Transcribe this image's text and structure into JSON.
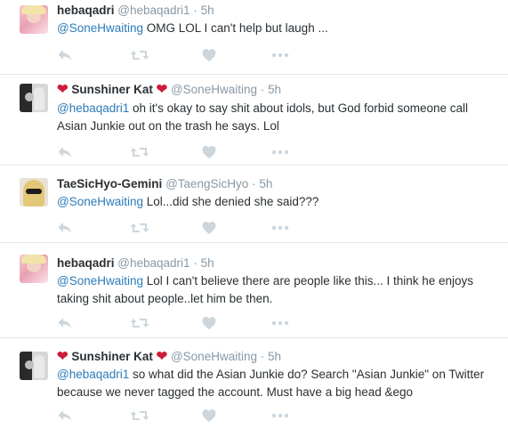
{
  "colors": {
    "name_text": "#292f33",
    "meta_text": "#8899a6",
    "link_blue": "#2b7bb9",
    "heart_red": "#cc1d3a",
    "action_icon": "#ccd6dd",
    "divider": "#e1e8ed"
  },
  "icons": [
    "reply-icon",
    "retweet-icon",
    "favorite-icon",
    "more-icon",
    "red-heart-emoji"
  ],
  "tweets": [
    {
      "fullname": "hebaqadri",
      "heart": "",
      "username": "@hebaqadri1",
      "sep": "·",
      "time": "5h",
      "mention": "@SoneHwaiting",
      "text": " OMG LOL I can't help but laugh ..."
    },
    {
      "fullname": "Sunshiner Kat",
      "heart": "❤",
      "username": "@SoneHwaiting",
      "sep": "·",
      "time": "5h",
      "mention": "@hebaqadri1",
      "text": " oh it's okay to say shit about idols, but God forbid someone call Asian Junkie out on the trash he says. Lol"
    },
    {
      "fullname": "TaeSicHyo-Gemini",
      "heart": "",
      "username": "@TaengSicHyo",
      "sep": "·",
      "time": "5h",
      "mention": "@SoneHwaiting",
      "text": " Lol...did she denied she said???"
    },
    {
      "fullname": "hebaqadri",
      "heart": "",
      "username": "@hebaqadri1",
      "sep": "·",
      "time": "5h",
      "mention": "@SoneHwaiting",
      "text": " Lol I can't believe there are people like this... I think he enjoys taking shit about people..let him be then."
    },
    {
      "fullname": "Sunshiner Kat",
      "heart": "❤",
      "username": "@SoneHwaiting",
      "sep": "·",
      "time": "5h",
      "mention": "@hebaqadri1",
      "text": " so what did the Asian Junkie do? Search \"Asian Junkie\" on Twitter because we never tagged the account. Must have a big head &ego"
    }
  ]
}
